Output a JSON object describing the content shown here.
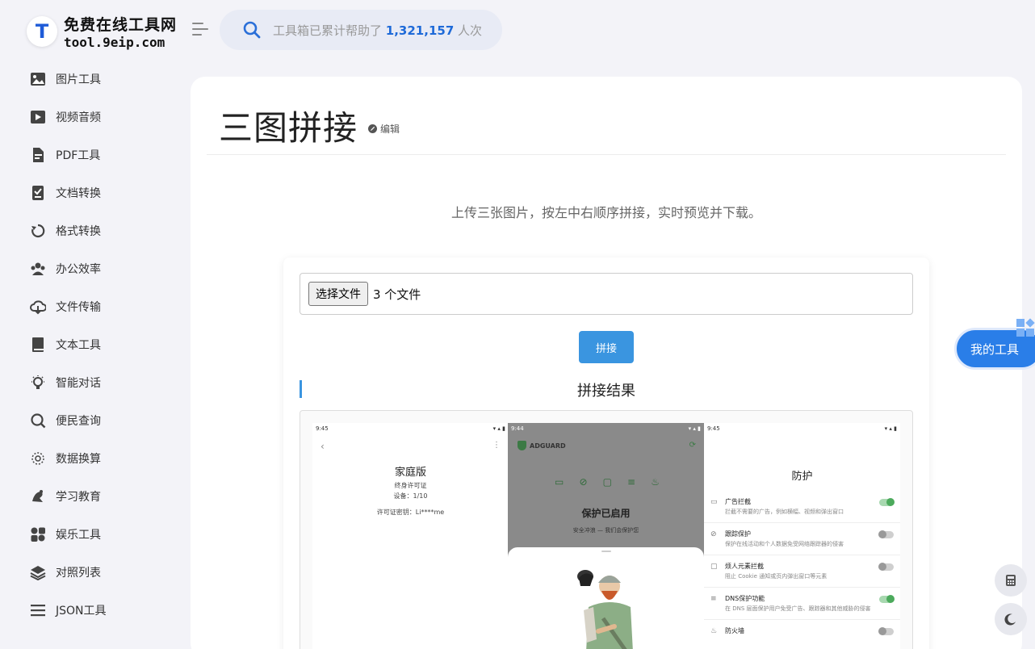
{
  "site": {
    "logo_letter": "T",
    "name": "免费在线工具网",
    "domain": "tool.9eip.com"
  },
  "search": {
    "prefix": "工具箱已累计帮助了",
    "count": "1,321,157",
    "suffix": "人次"
  },
  "sidebar": {
    "items": [
      {
        "label": "图片工具",
        "icon": "image-icon"
      },
      {
        "label": "视频音频",
        "icon": "video-icon"
      },
      {
        "label": "PDF工具",
        "icon": "pdf-icon"
      },
      {
        "label": "文档转换",
        "icon": "document-icon"
      },
      {
        "label": "格式转换",
        "icon": "convert-icon"
      },
      {
        "label": "办公效率",
        "icon": "team-icon"
      },
      {
        "label": "文件传输",
        "icon": "cloud-transfer-icon"
      },
      {
        "label": "文本工具",
        "icon": "book-icon"
      },
      {
        "label": "智能对话",
        "icon": "bulb-icon"
      },
      {
        "label": "便民查询",
        "icon": "search-icon"
      },
      {
        "label": "数据换算",
        "icon": "data-icon"
      },
      {
        "label": "学习教育",
        "icon": "education-icon"
      },
      {
        "label": "娱乐工具",
        "icon": "apps-icon"
      },
      {
        "label": "对照列表",
        "icon": "layers-icon"
      },
      {
        "label": "JSON工具",
        "icon": "list-icon"
      }
    ]
  },
  "page": {
    "title": "三图拼接",
    "edit_label": "编辑",
    "description": "上传三张图片，按左中右顺序拼接，实时预览并下载。",
    "file_button": "选择文件",
    "file_count": "3 个文件",
    "join_button": "拼接",
    "result_title": "拼接结果"
  },
  "preview": {
    "left": {
      "time": "9:45",
      "title": "家庭版",
      "license": "终身许可证",
      "devices": "设备：1/10",
      "key": "许可证密钥：Li****me"
    },
    "middle": {
      "time": "9:44",
      "brand": "ADGUARD",
      "status": "保护已启用",
      "sub": "安全冲浪 — 我们会保护您"
    },
    "right": {
      "time": "9:45",
      "title": "防护",
      "rows": [
        {
          "title": "广告拦截",
          "desc": "拦截不需要的广告，例如横幅、视频和弹出窗口",
          "on": true
        },
        {
          "title": "跟踪保护",
          "desc": "保护在线活动和个人数据免受网络跟踪器的侵害",
          "on": false
        },
        {
          "title": "烦人元素拦截",
          "desc": "阻止 Cookie 通知或页内弹出窗口等元素",
          "on": false
        },
        {
          "title": "DNS保护功能",
          "desc": "在 DNS 层面保护用户免受广告、跟踪器和其他威胁的侵害",
          "on": true
        },
        {
          "title": "防火墙",
          "desc": "",
          "on": false
        }
      ]
    }
  },
  "floating": {
    "my_tools": "我的工具"
  },
  "colors": {
    "accent": "#2a7ee8",
    "button": "#3a95e0",
    "background": "#f3f3f8"
  }
}
